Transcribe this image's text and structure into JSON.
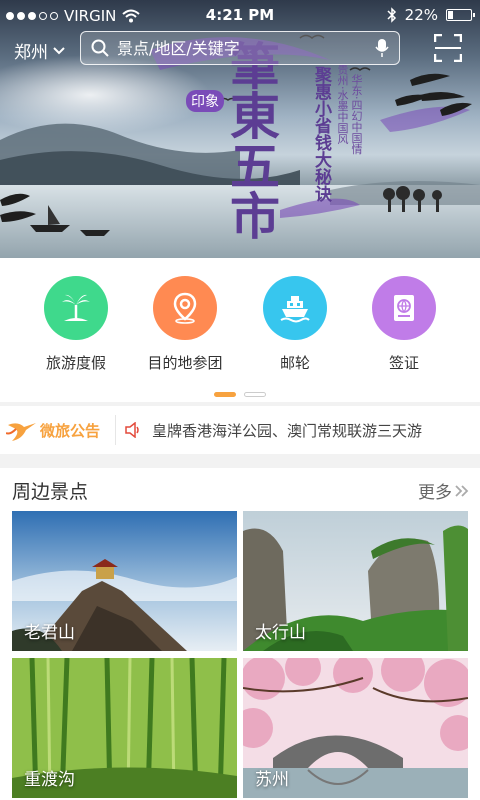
{
  "status_bar": {
    "carrier": "VIRGIN",
    "time": "4:21 PM",
    "battery": "22%",
    "battery_level": 0.22
  },
  "header": {
    "city": "郑州",
    "search_placeholder": "景点/地区/关键字"
  },
  "banner": {
    "title_main": "筆東五市",
    "stamp": "印象",
    "subtitle": "聚惠小省钱大秘诀",
    "poem_a": "贵州·水墨中国风",
    "poem_b": "华东·四幻中国情"
  },
  "categories": [
    {
      "label": "旅游度假",
      "icon": "palm-island-icon",
      "color": "#3fd98c"
    },
    {
      "label": "目的地参团",
      "icon": "location-pin-icon",
      "color": "#ff8a52"
    },
    {
      "label": "邮轮",
      "icon": "cruise-ship-icon",
      "color": "#37c6ee"
    },
    {
      "label": "签证",
      "icon": "passport-icon",
      "color": "#c07ce8"
    }
  ],
  "pager": {
    "pages": 2,
    "current": 1
  },
  "notice": {
    "brand": "微旅公告",
    "text": "皇牌香港海洋公园、澳门常规联游三天游"
  },
  "nearby": {
    "title": "周边景点",
    "more": "更多",
    "spots": [
      {
        "name": "老君山"
      },
      {
        "name": "太行山"
      },
      {
        "name": "重渡沟"
      },
      {
        "name": "苏州"
      }
    ]
  },
  "colors": {
    "accent": "#f7a23f",
    "banner_ink": "#5c3d93"
  }
}
